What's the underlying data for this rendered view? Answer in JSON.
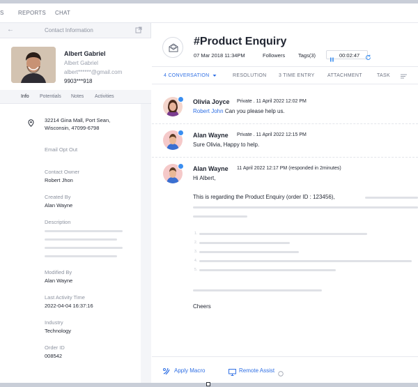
{
  "topnav": {
    "item_s": "S",
    "reports": "REPORTS",
    "chat": "CHAT"
  },
  "contact_panel": {
    "header_title": "Contact Information",
    "name": "Albert Gabriel",
    "subname": "Albert Gabriel",
    "email": "albert******@gmail.com",
    "phone": "9903***918",
    "tabs": [
      "Info",
      "Potentials",
      "Notes",
      "Activities"
    ],
    "address_line1": "32214 Gina Mall, Port Sean,",
    "address_line2": "Wisconsin, 47099-6798",
    "email_opt_out_label": "Email Opt Out",
    "fields": [
      {
        "label": "Contact Owner",
        "value": "Robert Jhon"
      },
      {
        "label": "Created By",
        "value": "Alan Wayne"
      },
      {
        "label": "Description",
        "value": ""
      },
      {
        "label": "Modified By",
        "value": "Alan Wayne"
      },
      {
        "label": "Last Activity Time",
        "value": "2022-04-04 16:37:16"
      },
      {
        "label": "Industry",
        "value": "Technology"
      },
      {
        "label": "Order ID",
        "value": "008542"
      }
    ]
  },
  "ticket": {
    "subject": "#Product Enquiry",
    "date": "07 Mar 2018 11:34PM",
    "followers": "Followers",
    "tags": "Tags(3)",
    "timer": "00:02:47",
    "tabs": [
      "4 CONVERSATION",
      "RESOLUTION",
      "3 TIME ENTRY",
      "ATTACHMENT",
      "TASK"
    ]
  },
  "messages": [
    {
      "author": "Olivia Joyce",
      "meta": "Private . 11 April 2022  12:02 PM",
      "mention": "Robert John",
      "text": "Can you please help us."
    },
    {
      "author": "Alan Wayne",
      "meta": "Private . 11 April 2022  12:15 PM",
      "text": "Sure Olivia, Happy to help."
    },
    {
      "author": "Alan Wayne",
      "meta": "11 April 2022  12:17 PM  (responded in 2minutes)",
      "greeting": "Hi Albert,",
      "body": "This is regarding the Product Enquiry (order ID : 123456),",
      "closing": "Cheers"
    }
  ],
  "footer": {
    "apply_macro": "Apply Macro",
    "remote_assist": "Remote Assist"
  },
  "colors": {
    "accent": "#2f6fe4",
    "badge": "#3a8ef0",
    "panel_bg": "#f4f5f8",
    "text": "#1f2430"
  },
  "icons": [
    "back-arrow-icon",
    "popout-icon",
    "location-pin-icon",
    "envelope-icon",
    "pause-icon",
    "refresh-icon",
    "chevron-down-icon",
    "menu-lines-icon",
    "macro-icon",
    "monitor-icon",
    "info-icon"
  ]
}
